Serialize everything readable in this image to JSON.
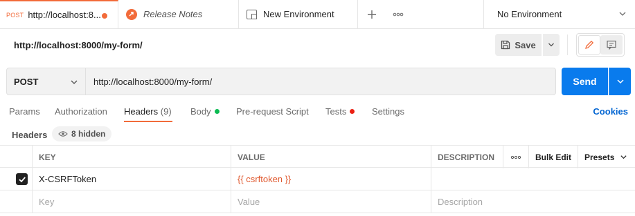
{
  "tabs": [
    {
      "method": "POST",
      "title": "http://localhost:8...",
      "unsaved": true
    },
    {
      "title": "Release Notes"
    },
    {
      "title": "New Environment"
    }
  ],
  "environment": {
    "selected": "No Environment"
  },
  "request": {
    "title": "http://localhost:8000/my-form/",
    "method": "POST",
    "url": "http://localhost:8000/my-form/"
  },
  "toolbar": {
    "save_label": "Save",
    "send_label": "Send"
  },
  "request_tabs": {
    "params": "Params",
    "authorization": "Authorization",
    "headers": "Headers",
    "headers_count": "(9)",
    "body": "Body",
    "pre_request": "Pre-request Script",
    "tests": "Tests",
    "settings": "Settings",
    "cookies": "Cookies"
  },
  "headers_section": {
    "label": "Headers",
    "hidden": "8 hidden"
  },
  "table": {
    "columns": {
      "key": "KEY",
      "value": "VALUE",
      "description": "DESCRIPTION",
      "bulk_edit": "Bulk Edit",
      "presets": "Presets"
    },
    "rows": [
      {
        "checked": true,
        "key": "X-CSRFToken",
        "value": "{{ csrftoken }}",
        "description": ""
      }
    ],
    "placeholders": {
      "key": "Key",
      "value": "Value",
      "description": "Description"
    }
  },
  "colors": {
    "accent": "#f26b3a",
    "send": "#097bed",
    "link": "#0265d2",
    "variable": "#e0592f",
    "body_dot": "#0cbb52",
    "tests_dot": "#eb2013"
  }
}
